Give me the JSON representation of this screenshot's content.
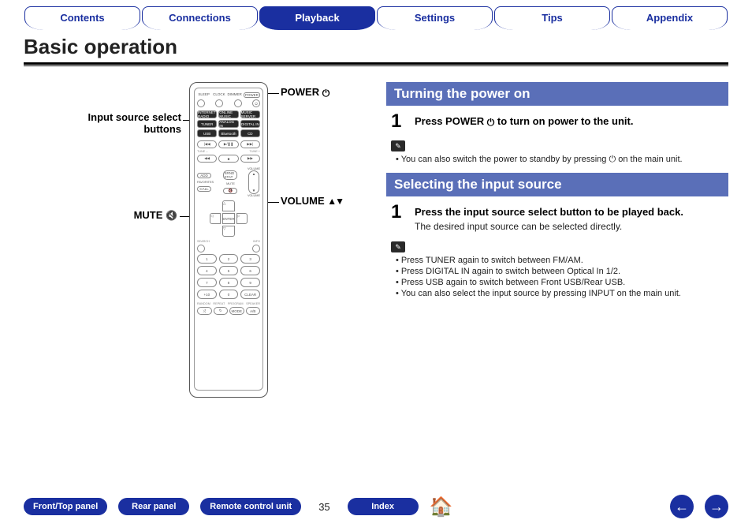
{
  "tabs": [
    "Contents",
    "Connections",
    "Playback",
    "Settings",
    "Tips",
    "Appendix"
  ],
  "active_tab": "Playback",
  "page_title": "Basic operation",
  "remote_callouts": {
    "power": "POWER",
    "input_source": "Input source select buttons",
    "volume": "VOLUME",
    "mute": "MUTE"
  },
  "section1": {
    "heading": "Turning the power on",
    "step_num": "1",
    "step_text_a": "Press POWER ",
    "step_text_b": " to turn on power to the unit.",
    "note1": "You can also switch the power to standby by pressing ",
    "note1b": " on the main unit."
  },
  "section2": {
    "heading": "Selecting the input source",
    "step_num": "1",
    "step_text": "Press the input source select button to be played back.",
    "step_sub": "The desired input source can be selected directly.",
    "notes": [
      "Press TUNER again to switch between FM/AM.",
      "Press DIGITAL IN again to switch between Optical In 1/2.",
      "Press USB again to switch between Front USB/Rear USB.",
      "You can also select the input source by pressing INPUT on the main unit."
    ]
  },
  "footer": {
    "buttons": [
      "Front/Top panel",
      "Rear panel",
      "Remote control unit",
      "Index"
    ],
    "page_number": "35"
  },
  "remote_keys": {
    "top_labels": [
      "SLEEP",
      "CLOCK",
      "DIMMER",
      "POWER"
    ],
    "src_row1": [
      "INTERNET RADIO",
      "ONLINE MUSIC",
      "MUSIC SERVER"
    ],
    "src_row2": [
      "TUNER",
      "ANALOG IN",
      "DIGITAL IN"
    ],
    "src_row3": [
      "USB",
      "Bluetooth",
      "CD"
    ],
    "tune_lbl": [
      "TUNE –",
      "TUNE +"
    ],
    "mid_left": [
      "ADD",
      "CALL"
    ],
    "mid_mid": [
      "SRND STAT",
      "MUTE"
    ],
    "mid_right": "VOLUME",
    "enter": "ENTER",
    "dir_lbl": [
      "SEARCH",
      "INFO"
    ],
    "num_sub": [
      "",
      ".@/:",
      "ABC",
      "DEF",
      "GHI",
      "JKL",
      "MNO",
      "PQRS",
      "TUV",
      "WXYZ",
      "",
      "",
      ""
    ],
    "nums": [
      "1",
      "2",
      "3",
      "4",
      "5",
      "6",
      "7",
      "8",
      "9",
      "+10",
      "0",
      "CLEAR"
    ],
    "bot_lbl": [
      "RANDOM",
      "REPEAT",
      "PROGRAM",
      "SPEAKER"
    ],
    "bot_row": [
      "⤮",
      "↻",
      "MODE",
      "A/B"
    ],
    "vol_lbl": "VOLUME"
  }
}
